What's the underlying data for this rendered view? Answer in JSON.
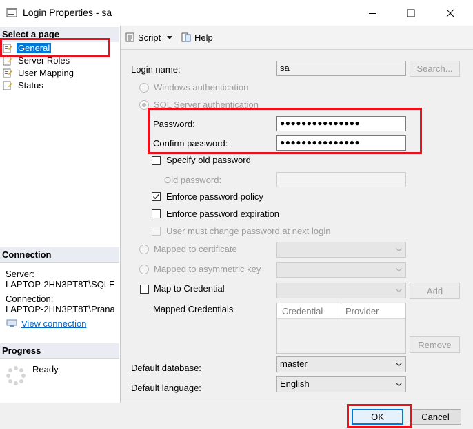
{
  "window": {
    "title": "Login Properties - sa"
  },
  "left": {
    "select_page_heading": "Select a page",
    "pages": [
      "General",
      "Server Roles",
      "User Mapping",
      "Status"
    ],
    "connection_heading": "Connection",
    "server_label": "Server:",
    "server_value": "LAPTOP-2HN3PT8T\\SQLE",
    "connection_label": "Connection:",
    "connection_value": "LAPTOP-2HN3PT8T\\Prana",
    "view_connection": "View connection",
    "progress_heading": "Progress",
    "progress_status": "Ready"
  },
  "toolbar": {
    "script": "Script",
    "help": "Help"
  },
  "form": {
    "login_name_label": "Login name:",
    "login_name_value": "sa",
    "search_button": "Search...",
    "windows_auth": "Windows authentication",
    "sql_auth": "SQL Server authentication",
    "password_label": "Password:",
    "password_value": "●●●●●●●●●●●●●●●",
    "confirm_label": "Confirm password:",
    "confirm_value": "●●●●●●●●●●●●●●●",
    "specify_old": "Specify old password",
    "old_password_label": "Old password:",
    "enforce_policy": "Enforce password policy",
    "enforce_expiration": "Enforce password expiration",
    "must_change": "User must change password at next login",
    "mapped_cert": "Mapped to certificate",
    "mapped_asym": "Mapped to asymmetric key",
    "map_credential": "Map to Credential",
    "add_button": "Add",
    "mapped_credentials": "Mapped Credentials",
    "cred_columns": [
      "Credential",
      "Provider"
    ],
    "remove_button": "Remove",
    "default_db_label": "Default database:",
    "default_db_value": "master",
    "default_lang_label": "Default language:",
    "default_lang_value": "English"
  },
  "footer": {
    "ok": "OK",
    "cancel": "Cancel"
  },
  "colors": {
    "highlight": "#e8121c",
    "selection": "#0078d7",
    "link": "#0066cc"
  }
}
